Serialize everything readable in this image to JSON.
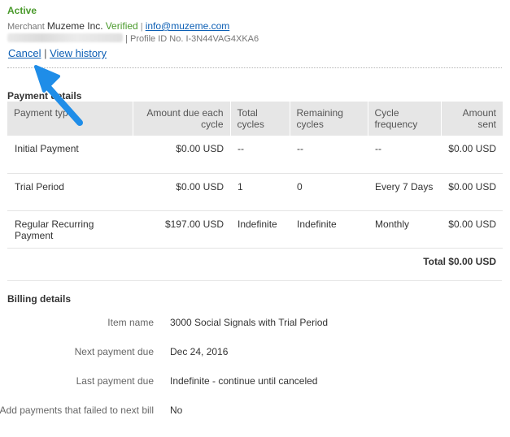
{
  "status": "Active",
  "merchant": {
    "label": "Merchant",
    "name": "Muzeme Inc.",
    "verified": "Verified",
    "separator": "|",
    "email": "info@muzeme.com"
  },
  "profile": {
    "separator": "|",
    "id_text": "Profile ID No. I-3N44VAG4XKA6"
  },
  "actions": {
    "cancel": "Cancel",
    "separator": "|",
    "view_history": "View history"
  },
  "payment_details": {
    "title": "Payment details",
    "columns": [
      "Payment type",
      "Amount due each cycle",
      "Total cycles",
      "Remaining cycles",
      "Cycle frequency",
      "Amount sent"
    ],
    "rows": [
      [
        "Initial Payment",
        "$0.00 USD",
        "--",
        "--",
        "--",
        "$0.00 USD"
      ],
      [
        "Trial Period",
        "$0.00 USD",
        "1",
        "0",
        "Every 7 Days",
        "$0.00 USD"
      ],
      [
        "Regular Recurring Payment",
        "$197.00 USD",
        "Indefinite",
        "Indefinite",
        "Monthly",
        "$0.00 USD"
      ]
    ],
    "total": "Total $0.00 USD"
  },
  "billing_details": {
    "title": "Billing details",
    "rows": [
      {
        "label": "Item name",
        "value": "3000 Social Signals with Trial Period"
      },
      {
        "label": "Next payment due",
        "value": "Dec 24, 2016"
      },
      {
        "label": "Last payment due",
        "value": "Indefinite - continue until canceled"
      },
      {
        "label": "Add payments that failed to next bill",
        "value": "No"
      }
    ]
  },
  "colors": {
    "status_green": "#4a9a2c",
    "link_blue": "#0b5eb4",
    "arrow_blue": "#1f8de8",
    "header_gray": "#e6e6e6"
  }
}
